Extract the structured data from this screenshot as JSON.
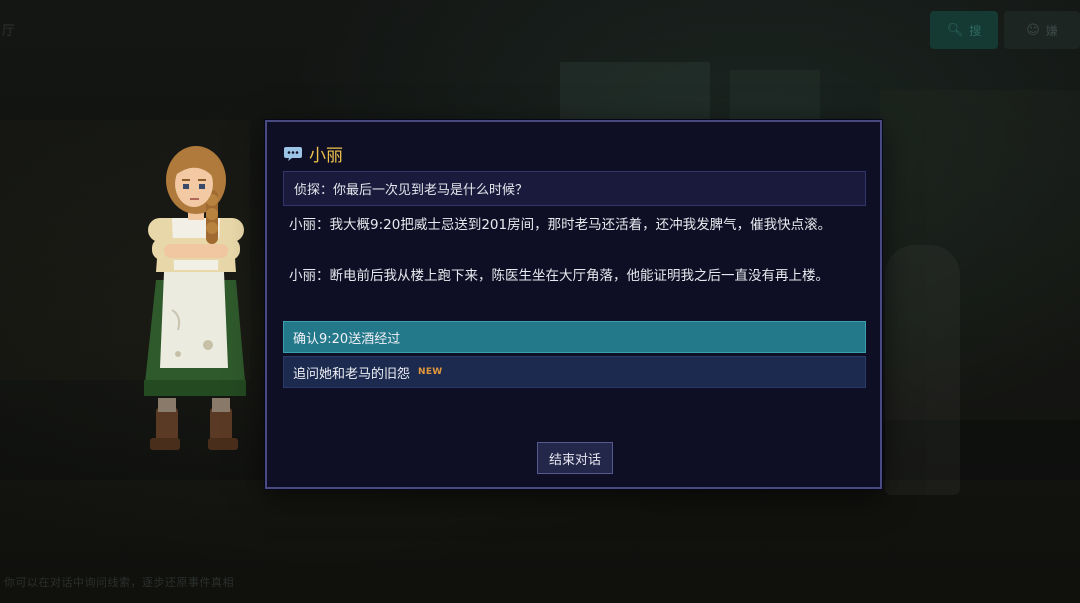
{
  "page": {
    "title_fragment": "厅"
  },
  "top_bar": {
    "button_1": {
      "icon": "search-icon",
      "label": "搜"
    },
    "button_2": {
      "icon": "person-icon",
      "label": "嫌"
    }
  },
  "status_line": "你可以在对话中询问线索，逐步还原事件真相",
  "dialog": {
    "speaker": "小丽",
    "speaker_color": "#f0c24a",
    "question": "侦探：你最后一次见到老马是什么时候？",
    "answers": [
      "小丽：我大概9:20把威士忌送到201房间，那时老马还活着，还冲我发脾气，催我快点滚。",
      "小丽：断电前后我从楼上跑下来，陈医生坐在大厅角落，他能证明我之后一直没有再上楼。"
    ],
    "options": [
      {
        "label": "确认9:20送酒经过",
        "selected": true,
        "badge": ""
      },
      {
        "label": "追问她和老马的旧怨",
        "selected": false,
        "badge": "NEW"
      }
    ],
    "end_button": "结束对话",
    "accent_selected": "#23798a",
    "badge_color": "#e2973a"
  }
}
